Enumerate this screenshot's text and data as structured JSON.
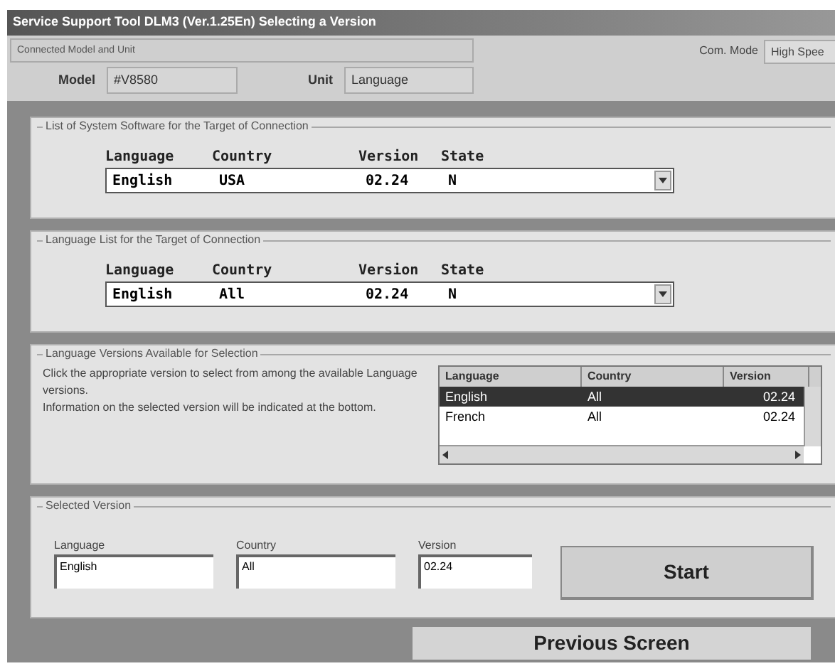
{
  "window": {
    "title": "Service Support Tool DLM3 (Ver.1.25En) Selecting a Version"
  },
  "connection": {
    "heading": "Connected Model and Unit",
    "com_mode_label": "Com. Mode",
    "com_mode_value": "High Spee",
    "model_label": "Model",
    "model_value": "#V8580",
    "unit_label": "Unit",
    "unit_value": "Language"
  },
  "system_software": {
    "title": "List of System Software for the Target of Connection",
    "columns": [
      "Language",
      "Country",
      "Version",
      "State"
    ],
    "row": [
      "English",
      "USA",
      "02.24",
      "N"
    ]
  },
  "language_list": {
    "title": "Language List for the Target of Connection",
    "columns": [
      "Language",
      "Country",
      "Version",
      "State"
    ],
    "row": [
      "English",
      "All",
      "02.24",
      "N"
    ]
  },
  "available": {
    "title": "Language Versions Available for Selection",
    "instructions": "Click the appropriate version to select from among the available Language versions.\nInformation on the selected version will be indicated at the bottom.",
    "columns": [
      "Language",
      "Country",
      "Version"
    ],
    "rows": [
      {
        "cells": [
          "English",
          "All",
          "02.24"
        ],
        "selected": true
      },
      {
        "cells": [
          "French",
          "All",
          "02.24"
        ],
        "selected": false
      }
    ]
  },
  "selected_version": {
    "title": "Selected Version",
    "fields": [
      {
        "label": "Language",
        "value": "English"
      },
      {
        "label": "Country",
        "value": "All"
      },
      {
        "label": "Version",
        "value": "02.24"
      }
    ],
    "start_button": "Start"
  },
  "previous_button": "Previous Screen"
}
